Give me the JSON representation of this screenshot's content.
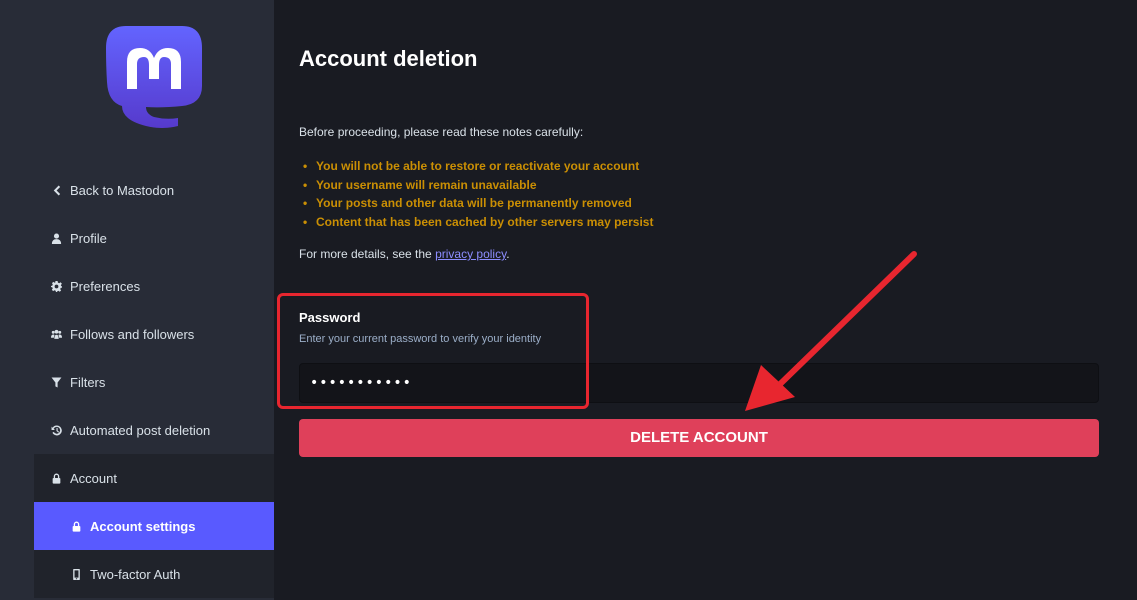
{
  "sidebar": {
    "items": [
      {
        "label": "Back to Mastodon",
        "icon": "chevron-left-icon"
      },
      {
        "label": "Profile",
        "icon": "user-icon"
      },
      {
        "label": "Preferences",
        "icon": "gear-icon"
      },
      {
        "label": "Follows and followers",
        "icon": "users-icon"
      },
      {
        "label": "Filters",
        "icon": "filter-icon"
      },
      {
        "label": "Automated post deletion",
        "icon": "history-icon"
      },
      {
        "label": "Account",
        "icon": "lock-icon"
      },
      {
        "label": "Account settings",
        "icon": "lock-icon",
        "active": true
      },
      {
        "label": "Two-factor Auth",
        "icon": "mobile-icon"
      }
    ]
  },
  "main": {
    "title": "Account deletion",
    "intro": "Before proceeding, please read these notes carefully:",
    "warnings": [
      "You will not be able to restore or reactivate your account",
      "Your username will remain unavailable",
      "Your posts and other data will be permanently removed",
      "Content that has been cached by other servers may persist"
    ],
    "details_prefix": "For more details, see the ",
    "details_link": "privacy policy",
    "details_suffix": ".",
    "password_label": "Password",
    "password_hint": "Enter your current password to verify your identity",
    "password_value": "•••••••••••",
    "delete_button": "DELETE ACCOUNT"
  },
  "colors": {
    "brand": "#595aff",
    "warning": "#ca8f04",
    "danger": "#df405a",
    "annotation": "#e8262f"
  }
}
